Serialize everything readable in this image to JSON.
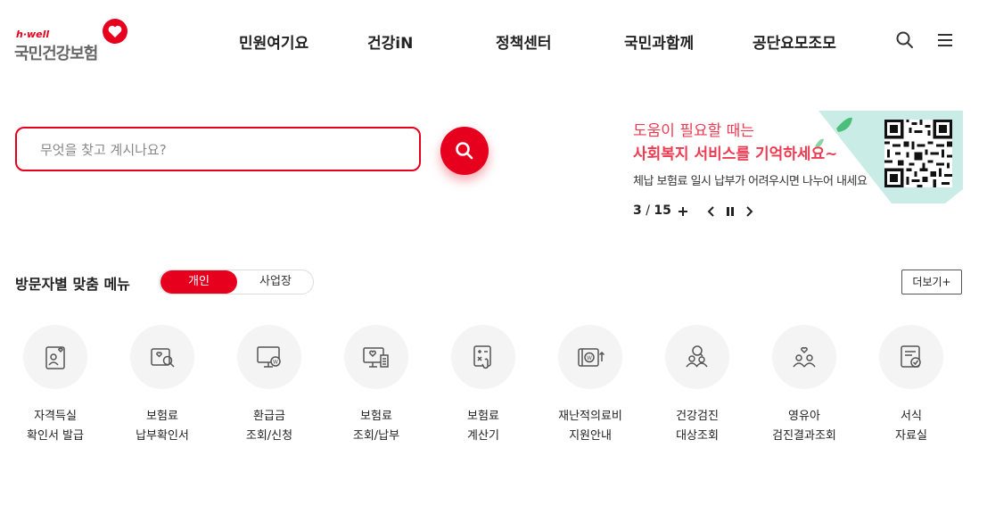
{
  "header": {
    "logo_tag": "h·well",
    "logo_text": "국민건강보험",
    "nav": [
      "민원여기요",
      "건강iN",
      "정책센터",
      "국민과함께",
      "공단요모조모"
    ]
  },
  "search": {
    "placeholder": "무엇을 찾고 계시나요?"
  },
  "banner": {
    "line1": "도움이 필요할 때는",
    "line2": "사회복지 서비스를 기억하세요~",
    "line3": "체납 보험료 일시 납부가 어려우시면 나누어 내세요",
    "current": "3",
    "separator": "/",
    "total": "15"
  },
  "menu_section": {
    "title": "방문자별 맞춤 메뉴",
    "toggle_on": "개인",
    "toggle_off": "사업장",
    "more": "더보기+",
    "items": [
      {
        "line1": "자격득실",
        "line2": "확인서 발급",
        "icon": "id-card-heart-icon"
      },
      {
        "line1": "보험료",
        "line2": "납부확인서",
        "icon": "document-search-icon"
      },
      {
        "line1": "환급금",
        "line2": "조회/신청",
        "icon": "monitor-won-icon"
      },
      {
        "line1": "보험료",
        "line2": "조회/납부",
        "icon": "monitor-receipt-icon"
      },
      {
        "line1": "보험료",
        "line2": "계산기",
        "icon": "calculator-icon"
      },
      {
        "line1": "재난적의료비",
        "line2": "지원안내",
        "icon": "wallet-won-icon"
      },
      {
        "line1": "건강검진",
        "line2": "대상조회",
        "icon": "people-search-icon"
      },
      {
        "line1": "영유아",
        "line2": "검진결과조회",
        "icon": "family-heart-icon"
      },
      {
        "line1": "서식",
        "line2": "자료실",
        "icon": "document-check-icon"
      }
    ]
  },
  "colors": {
    "accent": "#e6001e",
    "banner_text": "#ee3b52",
    "banner_bg": "#c9ece6"
  }
}
